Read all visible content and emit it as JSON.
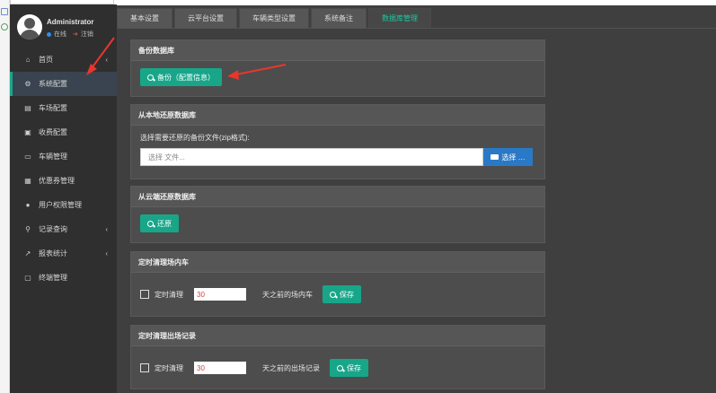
{
  "user": {
    "name": "Administrator",
    "online": "在线",
    "logout": "注销"
  },
  "nav": [
    {
      "label": "首页",
      "icon": "home-icon",
      "glyph": "⌂",
      "chevron": true
    },
    {
      "label": "系统配置",
      "icon": "gears-icon",
      "glyph": "⚙",
      "active": true
    },
    {
      "label": "车场配置",
      "icon": "document-icon",
      "glyph": "▤"
    },
    {
      "label": "收费配置",
      "icon": "money-icon",
      "glyph": "▣"
    },
    {
      "label": "车辆管理",
      "icon": "car-icon",
      "glyph": "▭"
    },
    {
      "label": "优惠券管理",
      "icon": "calendar-icon",
      "glyph": "▦"
    },
    {
      "label": "用户权限管理",
      "icon": "user-circle-icon",
      "glyph": "●"
    },
    {
      "label": "记录查询",
      "icon": "search-icon",
      "glyph": "⚲",
      "chevron": true
    },
    {
      "label": "报表统计",
      "icon": "line-chart-icon",
      "glyph": "↗",
      "chevron": true
    },
    {
      "label": "终端管理",
      "icon": "monitor-icon",
      "glyph": "▢"
    }
  ],
  "tabs": [
    "基本设置",
    "云平台设置",
    "车辆类型设置",
    "系统备注",
    "数据库管理"
  ],
  "backup": {
    "title": "备份数据库",
    "button": "备份（配置信息）"
  },
  "restore_local": {
    "title": "从本地还原数据库",
    "label": "选择需要还原的备份文件(zip格式):",
    "placeholder": "选择 文件...",
    "choose": "选择 …"
  },
  "restore_cloud": {
    "title": "从云端还原数据库",
    "button": "还原"
  },
  "clean_in": {
    "title": "定时清理场内车",
    "check_label": "定时清理",
    "days": "30",
    "after": "天之前的场内车",
    "save": "保存"
  },
  "clean_out": {
    "title": "定时清理出场记录",
    "check_label": "定时清理",
    "days": "30",
    "after": "天之前的出场记录",
    "save": "保存"
  }
}
